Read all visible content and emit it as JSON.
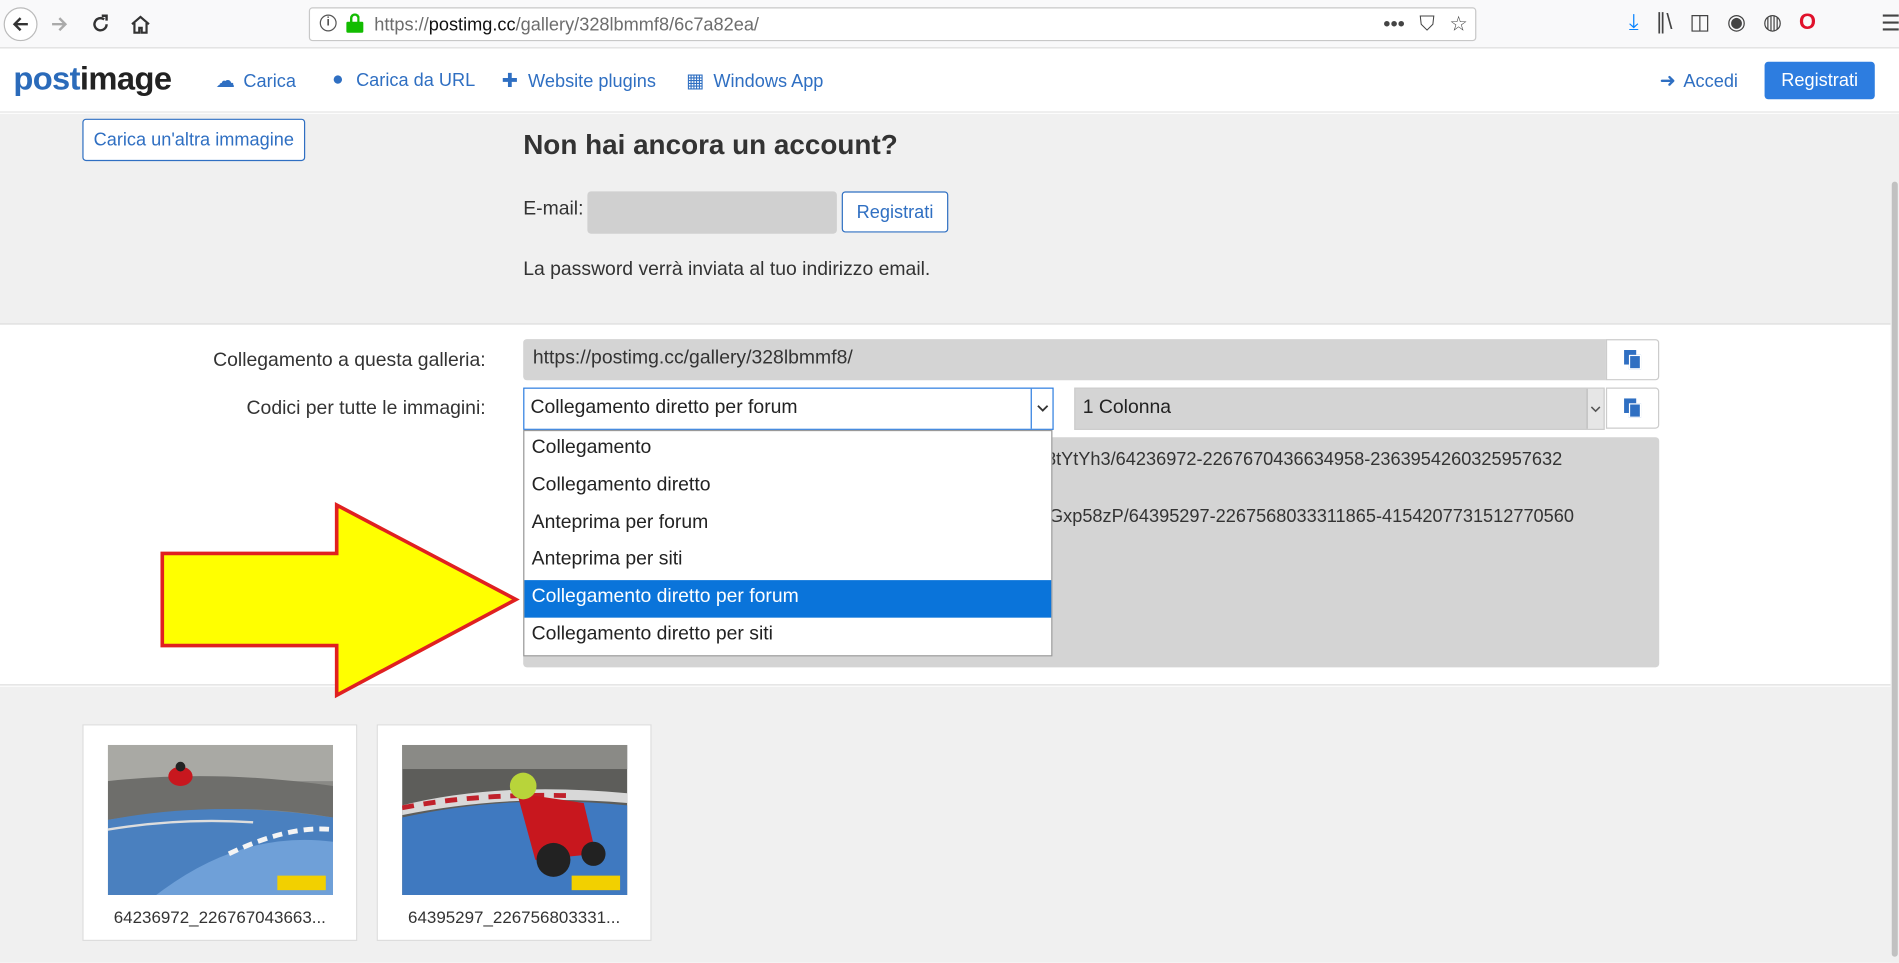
{
  "browser": {
    "url_prefix": "https://",
    "url_domain": "postimg.cc",
    "url_path": "/gallery/328lbmmf8/6c7a82ea/",
    "url_actions": [
      "•••",
      "⛉",
      "☆"
    ]
  },
  "header": {
    "logo_part1": "post",
    "logo_part2": "image",
    "nav": [
      {
        "label": "Carica",
        "icon": "cloud-upload-icon"
      },
      {
        "label": "Carica da URL",
        "icon": "globe-icon"
      },
      {
        "label": "Website plugins",
        "icon": "puzzle-icon"
      },
      {
        "label": "Windows App",
        "icon": "windows-icon"
      }
    ],
    "login_label": "Accedi",
    "register_label": "Registrati"
  },
  "account": {
    "upload_more_label": "Carica un'altra immagine",
    "title": "Non hai ancora un account?",
    "email_label": "E-mail:",
    "email_value": "",
    "register_label": "Registrati",
    "password_note": "La password verrà inviata al tuo indirizzo email."
  },
  "links": {
    "gallery_link_label": "Collegamento a questa galleria:",
    "gallery_link_value": "https://postimg.cc/gallery/328lbmmf8/",
    "codes_label": "Codici per tutte le immagini:",
    "format_selected": "Collegamento diretto per forum",
    "columns_selected": "1 Colonna",
    "code_lines": [
      "c/K8tYtYh3/64236972-2267670436634958-2363954260325957632",
      "c/MGxp58zP/64395297-2267568033311865-4154207731512770560"
    ],
    "format_options": [
      "Collegamento",
      "Collegamento diretto",
      "Anteprima per forum",
      "Anteprima per siti",
      "Collegamento diretto per forum",
      "Collegamento diretto per siti"
    ],
    "format_selected_index": 4
  },
  "gallery": {
    "images": [
      {
        "caption": "64236972_226767043663..."
      },
      {
        "caption": "64395297_226756803331..."
      }
    ]
  },
  "colors": {
    "accent": "#2d7de0",
    "arrow_fill": "#ffff00",
    "arrow_stroke": "#e02020"
  }
}
